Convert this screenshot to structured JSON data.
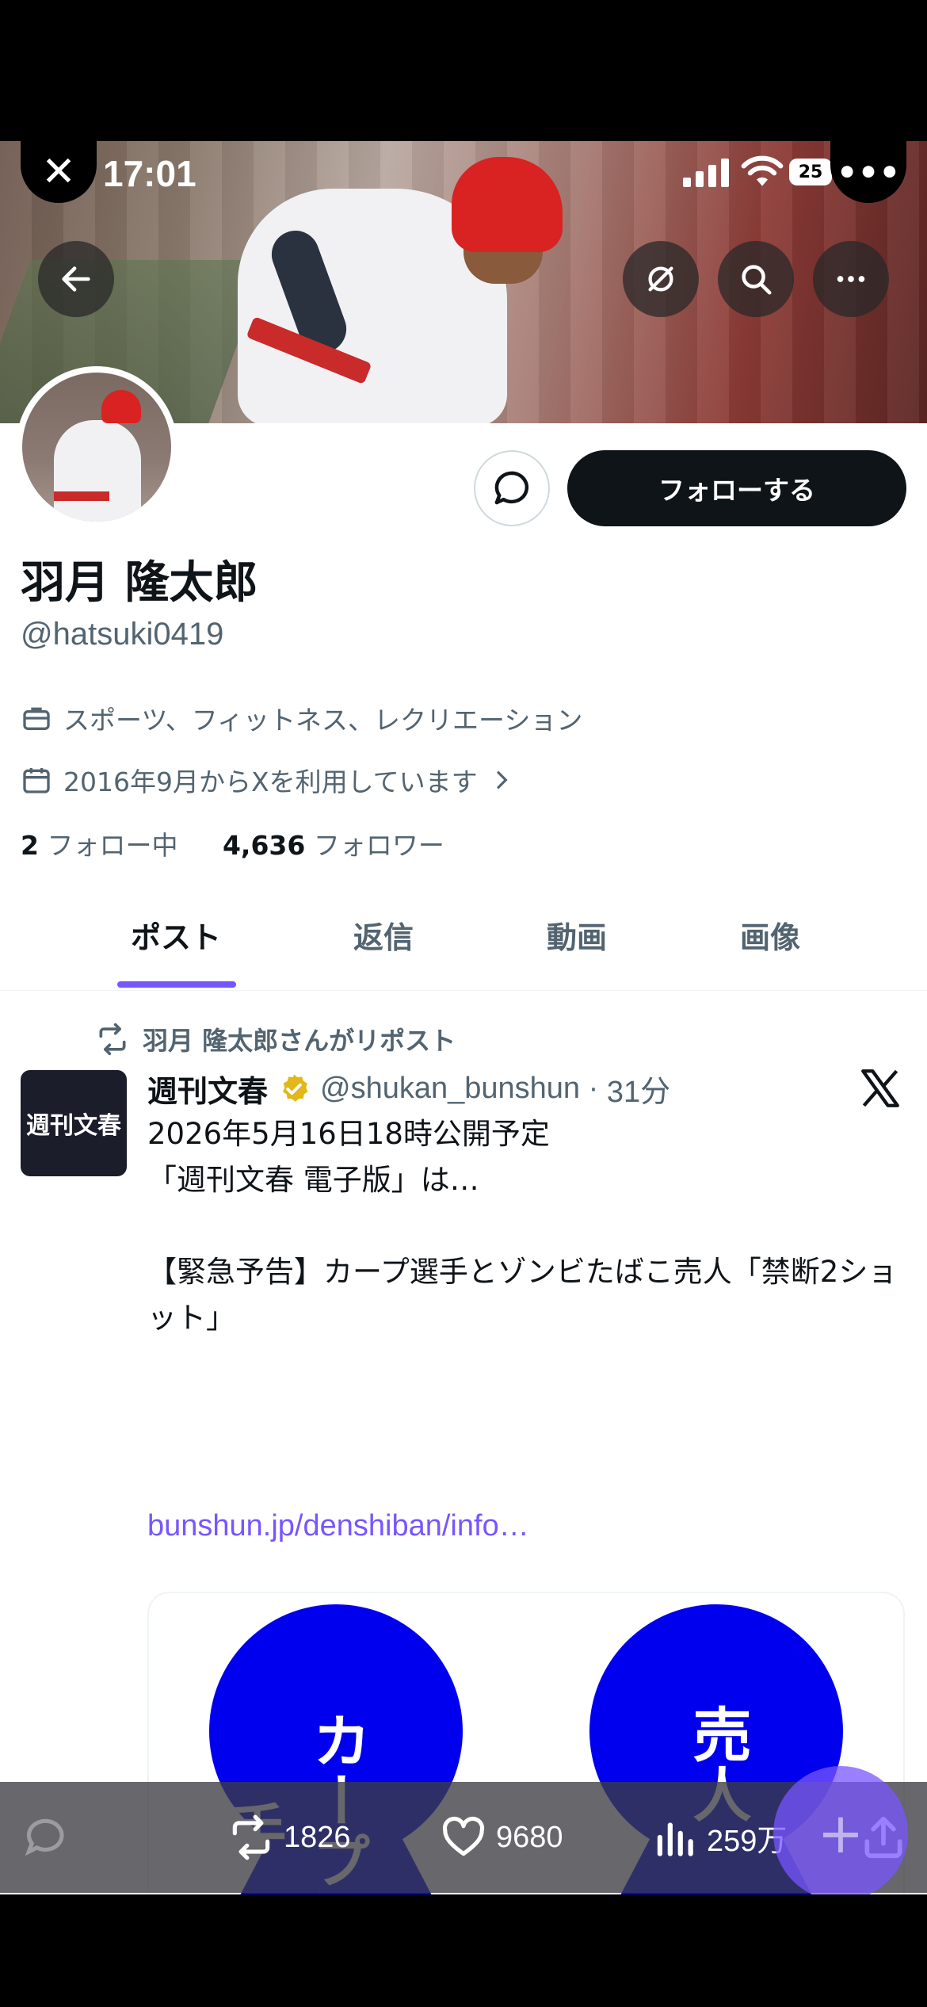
{
  "status_bar": {
    "time": "17:01",
    "battery": "25"
  },
  "profile": {
    "name": "羽月 隆太郎",
    "handle": "@hatsuki0419",
    "category": "スポーツ、フィットネス、レクリエーション",
    "joined": "2016年9月からXを利用しています",
    "following_count": "2",
    "following_label": "フォロー中",
    "followers_count": "4,636",
    "followers_label": "フォロワー",
    "follow_button": "フォローする"
  },
  "tabs": [
    {
      "label": "ポスト",
      "active": true
    },
    {
      "label": "返信"
    },
    {
      "label": "動画"
    },
    {
      "label": "画像"
    }
  ],
  "post": {
    "repost_label": "羽月 隆太郎さんがリポスト",
    "avatar_text": "週刊文春",
    "author": "週刊文春",
    "author_handle": "@shukan_bunshun",
    "age": "31分",
    "text": "2026年5月16日18時公開予定\n「週刊文春 電子版」は…\n\n【緊急予告】カープ選手とゾンビたばこ売人「禁断2ショット」",
    "link": "bunshun.jp/denshiban/info…",
    "card_labels": [
      "カープ選手",
      "売人"
    ],
    "reposts": "1826",
    "likes": "9680",
    "views": "259万"
  },
  "colors": {
    "accent": "#7856ff",
    "card_blue": "#0000ee",
    "verified_gold": "#e2b719"
  }
}
